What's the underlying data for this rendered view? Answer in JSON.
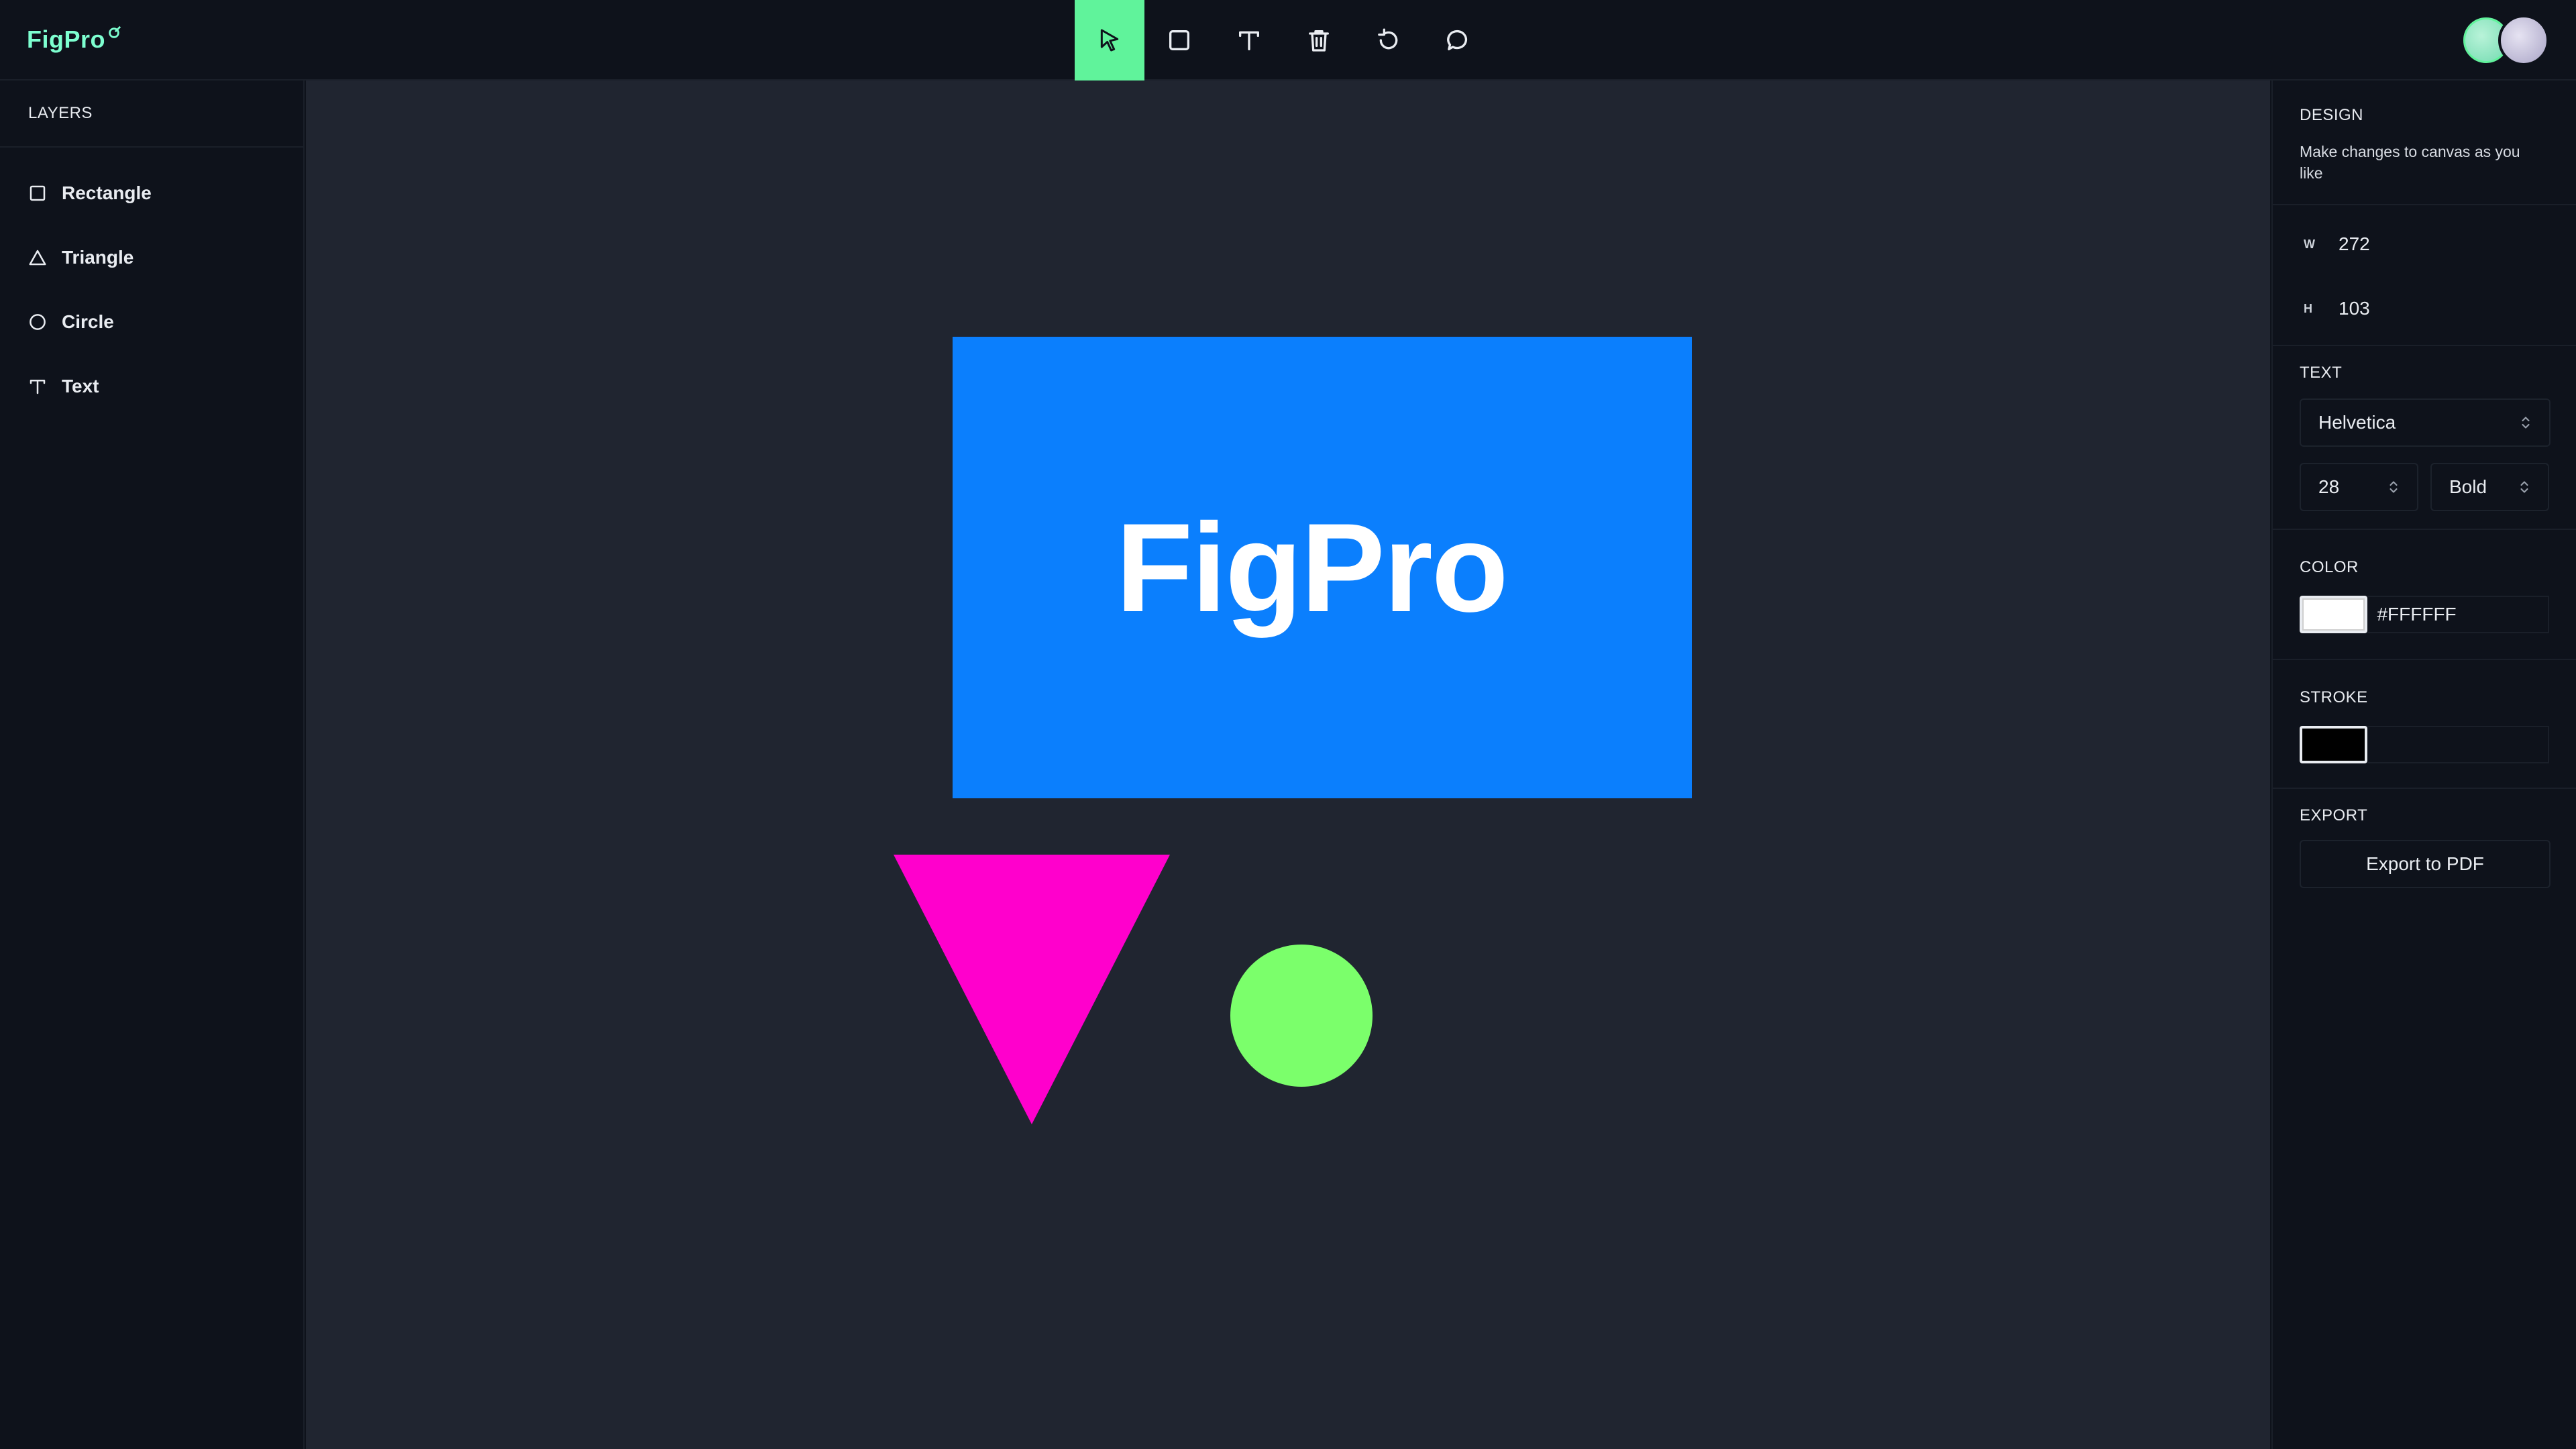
{
  "app": {
    "name": "FigPro",
    "accent": "#60f39b",
    "logo_color": "#7dffd0"
  },
  "toolbar": {
    "tools": [
      {
        "name": "select",
        "icon": "cursor-icon",
        "active": true
      },
      {
        "name": "rectangle",
        "icon": "square-icon",
        "active": false
      },
      {
        "name": "text",
        "icon": "text-icon",
        "active": false
      },
      {
        "name": "delete",
        "icon": "trash-icon",
        "active": false
      },
      {
        "name": "reset",
        "icon": "rotate-icon",
        "active": false
      },
      {
        "name": "comments",
        "icon": "comment-icon",
        "active": false
      }
    ]
  },
  "layers": {
    "heading": "LAYERS",
    "items": [
      {
        "label": "Rectangle",
        "icon": "square-icon"
      },
      {
        "label": "Triangle",
        "icon": "triangle-icon"
      },
      {
        "label": "Circle",
        "icon": "circle-icon"
      },
      {
        "label": "Text",
        "icon": "text-icon"
      }
    ]
  },
  "canvas": {
    "background": "#202530",
    "rectangle": {
      "color": "#0b7ffd",
      "text": "FigPro",
      "text_color": "#ffffff"
    },
    "triangle": {
      "color": "#ff00cc"
    },
    "circle": {
      "color": "#7bff6b"
    }
  },
  "design": {
    "title": "DESIGN",
    "description": "Make changes to canvas as you like",
    "width_label": "W",
    "width_value": "272",
    "height_label": "H",
    "height_value": "103",
    "text_heading": "TEXT",
    "font_family": "Helvetica",
    "font_size": "28",
    "font_weight": "Bold",
    "color_heading": "COLOR",
    "color_value": "#FFFFFF",
    "stroke_heading": "STROKE",
    "stroke_value": "",
    "export_heading": "EXPORT",
    "export_label": "Export to PDF"
  }
}
